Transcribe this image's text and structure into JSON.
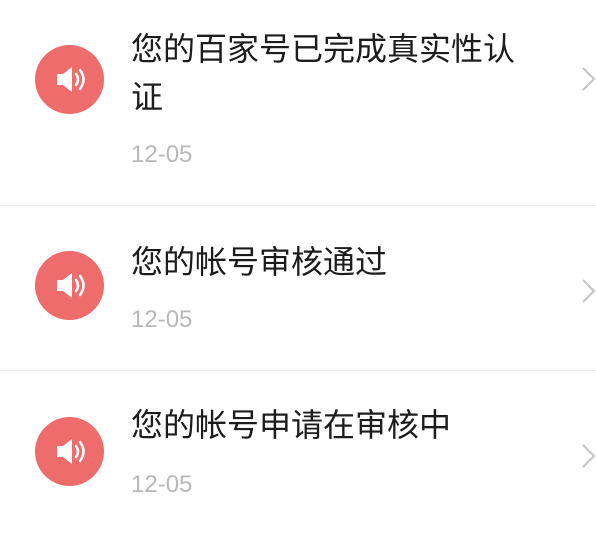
{
  "colors": {
    "icon_background": "#ee6c6c",
    "title_text": "#1c1c1c",
    "date_text": "#b8b8b8",
    "divider": "#ececec",
    "chevron": "#c4c4c4"
  },
  "notifications": [
    {
      "icon": "speaker-icon",
      "title": "您的百家号已完成真实性认证",
      "date": "12-05"
    },
    {
      "icon": "speaker-icon",
      "title": "您的帐号审核通过",
      "date": "12-05"
    },
    {
      "icon": "speaker-icon",
      "title": "您的帐号申请在审核中",
      "date": "12-05"
    }
  ]
}
